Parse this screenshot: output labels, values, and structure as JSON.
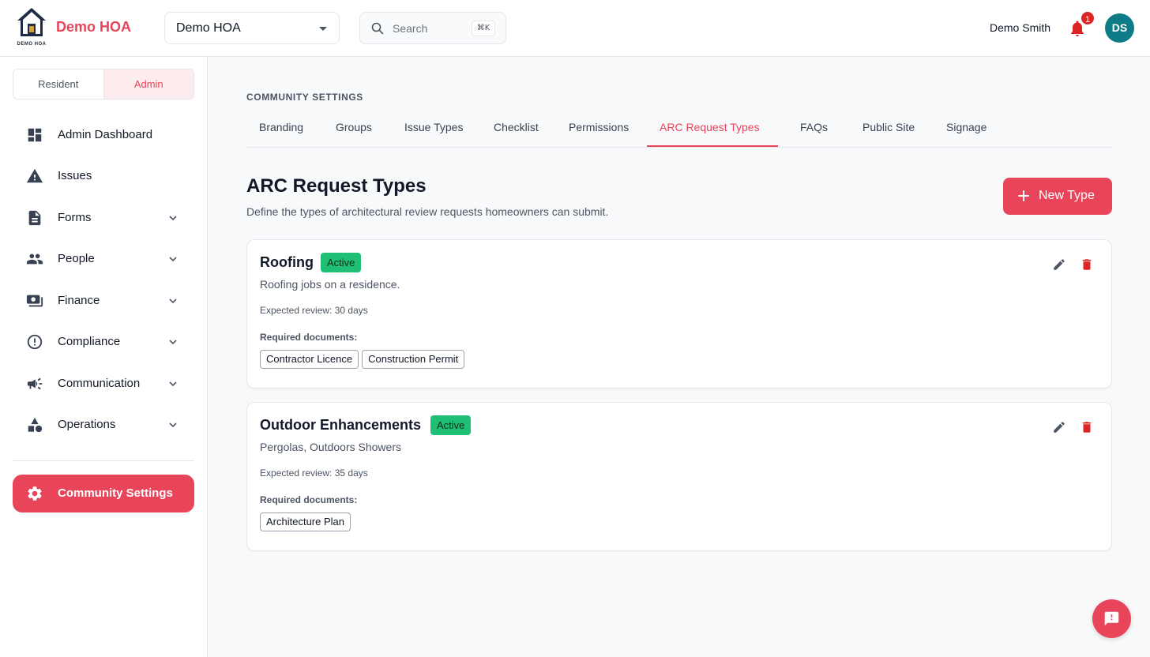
{
  "header": {
    "logo_text": "DEMO HOA",
    "brand": "Demo HOA",
    "hoa_select": "Demo HOA",
    "search_placeholder": "Search",
    "search_shortcut": "⌘K",
    "user_name": "Demo Smith",
    "notification_count": "1",
    "avatar_initials": "DS",
    "brand_color": "#e8455a"
  },
  "sidebar": {
    "roles": [
      "Resident",
      "Admin"
    ],
    "active_role": "Admin",
    "items": [
      {
        "label": "Admin Dashboard",
        "icon": "dashboard-icon",
        "expandable": false
      },
      {
        "label": "Issues",
        "icon": "warning-icon",
        "expandable": false
      },
      {
        "label": "Forms",
        "icon": "document-icon",
        "expandable": true
      },
      {
        "label": "People",
        "icon": "people-icon",
        "expandable": true
      },
      {
        "label": "Finance",
        "icon": "money-icon",
        "expandable": true
      },
      {
        "label": "Compliance",
        "icon": "exclamation-circle-icon",
        "expandable": true
      },
      {
        "label": "Communication",
        "icon": "megaphone-icon",
        "expandable": true
      },
      {
        "label": "Operations",
        "icon": "shapes-icon",
        "expandable": true
      }
    ],
    "settings_label": "Community Settings"
  },
  "main": {
    "section_label": "COMMUNITY SETTINGS",
    "tabs": [
      "Branding",
      "Groups",
      "Issue Types",
      "Checklist",
      "Permissions",
      "ARC Request Types",
      "FAQs",
      "Public Site",
      "Signage"
    ],
    "active_tab": "ARC Request Types",
    "title": "ARC Request Types",
    "subtitle": "Define the types of architectural review requests homeowners can submit.",
    "new_button": "New Type",
    "cards": [
      {
        "title": "Roofing",
        "status": "Active",
        "description": "Roofing jobs on a residence.",
        "review": "Expected review: 30 days",
        "required_label": "Required documents:",
        "documents": [
          "Contractor Licence",
          "Construction Permit"
        ]
      },
      {
        "title": "Outdoor Enhancements",
        "status": "Active",
        "description": "Pergolas, Outdoors Showers",
        "review": "Expected review: 35 days",
        "required_label": "Required documents:",
        "documents": [
          "Architecture Plan"
        ]
      }
    ]
  }
}
